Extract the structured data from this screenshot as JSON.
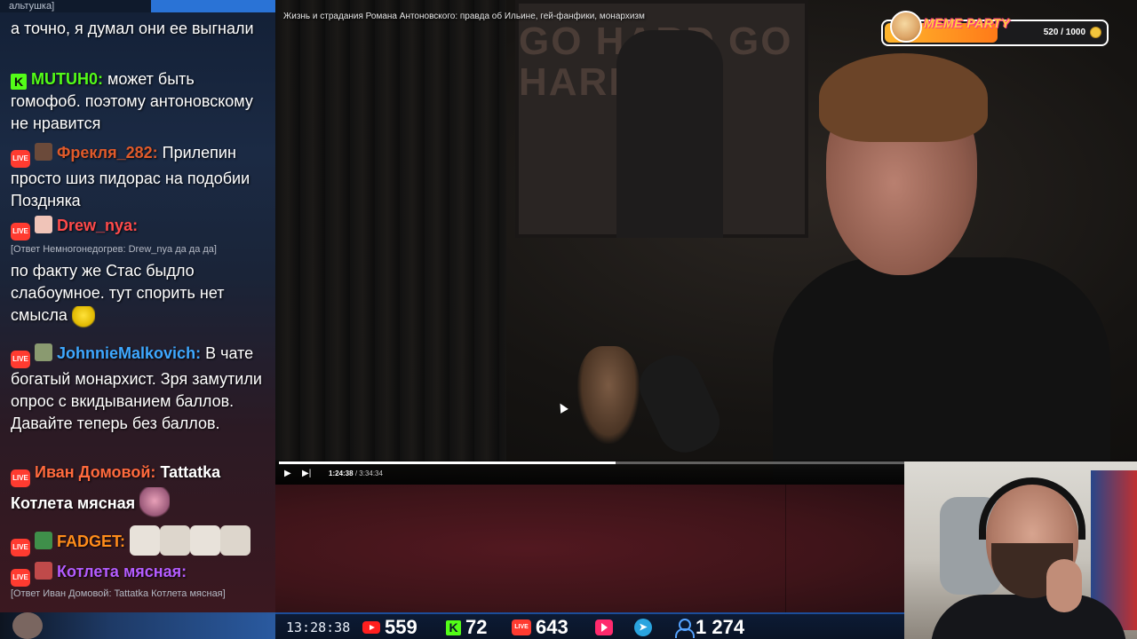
{
  "chat": {
    "cut_off_text": "альтушка]",
    "messages": [
      {
        "text": "а точно, я думал они ее выгнали"
      },
      {
        "platform": "K",
        "user": "MUTUH0:",
        "user_color": "#53fc18",
        "text": "может быть гомофоб. поэтому антоновскому не нравится"
      },
      {
        "platform": "LIVE",
        "user": "Фрекля_282:",
        "user_color": "#e05a2a",
        "text": "Прилепин просто шиз пидорас на подобии Позднякa"
      },
      {
        "platform": "LIVE",
        "user": "Drew_nya:",
        "user_color": "#ff4a4a",
        "reply": "[Ответ Немногонедогрев: Drew_nya да да да]",
        "text": "по факту же Стас быдло слабоумное. тут спорить нет смысла"
      },
      {
        "platform": "LIVE",
        "user": "JohnnieMalkovich:",
        "user_color": "#3ea8ff",
        "text": "В чате богатый монархист. Зря замутили опрос с вкидыванием баллов. Давайте теперь без баллов."
      },
      {
        "platform": "LIVE",
        "user": "Иван Домовой:",
        "user_color": "#ff6a3d",
        "text": "Tattatka Котлета мясная"
      },
      {
        "platform": "LIVE",
        "user": "FADGET:",
        "user_color": "#ff8c1a",
        "text": ""
      },
      {
        "platform": "LIVE",
        "user": "Котлета мясная:",
        "user_color": "#b45cff",
        "reply": "[Ответ Иван Домовой: Tattatka Котлета мясная]",
        "text": ""
      }
    ]
  },
  "video": {
    "title": "Жизнь и страдания Романа Антоновского: правда об Ильине, гей-фанфики, монархизм",
    "poster_text": "GO HARD GO HARD",
    "current_time": "1:24:38",
    "duration": "3:34:34",
    "progress": 0.394
  },
  "meme_party": {
    "label": "MEME PARTY",
    "score": "520 / 1000",
    "fill": 0.52
  },
  "stats": {
    "clock": "13:28:38",
    "youtube_viewers": "559",
    "kick_viewers": "72",
    "live_viewers": "643",
    "total_viewers": "1 274",
    "live_badge": "LIVE",
    "kick_badge": "K"
  },
  "colors": {
    "accent": "#2a73d6",
    "live_red": "#ff3b30",
    "kick_green": "#53fc18",
    "panel_red": "#3e1419"
  },
  "icons": [
    "youtube-icon",
    "kick-icon",
    "live-icon",
    "play-icon",
    "telegram-icon",
    "user-icon",
    "coin-icon",
    "doge-icon"
  ]
}
